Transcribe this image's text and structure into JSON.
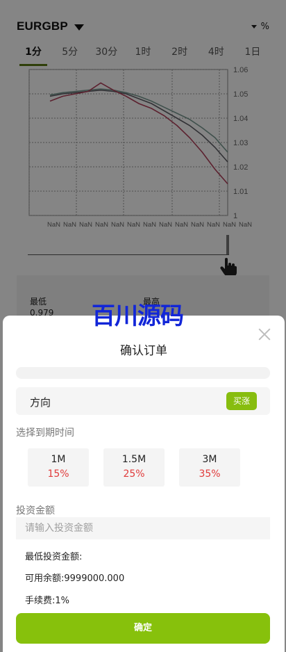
{
  "header": {
    "pair": "EURGBP",
    "percent_toggle": "%"
  },
  "timeframes": [
    {
      "label": "1分",
      "active": true
    },
    {
      "label": "5分",
      "active": false
    },
    {
      "label": "30分",
      "active": false
    },
    {
      "label": "1时",
      "active": false
    },
    {
      "label": "2时",
      "active": false
    },
    {
      "label": "4时",
      "active": false
    },
    {
      "label": "1日",
      "active": false
    }
  ],
  "chart_data": {
    "type": "line",
    "yticks": [
      "1.06",
      "1.05",
      "1.04",
      "1.03",
      "1.02",
      "1.01",
      "1"
    ],
    "ylim": [
      1.0,
      1.06
    ],
    "xtick_labels": [
      "NaN",
      "NaN",
      "NaN",
      "NaN",
      "NaN",
      "NaN",
      "NaN",
      "NaN",
      "NaN",
      "NaN",
      "NaN",
      "NaN",
      "NaN"
    ],
    "grid": true,
    "series": [
      {
        "color": "#7a9a92",
        "y": [
          1.0495,
          1.0505,
          1.051,
          1.0515,
          1.052,
          1.0515,
          1.0505,
          1.049,
          1.047,
          1.0445,
          1.042,
          1.0395,
          1.036,
          1.032,
          1.026
        ]
      },
      {
        "color": "#5e5e66",
        "y": [
          1.049,
          1.05,
          1.0505,
          1.051,
          1.0515,
          1.051,
          1.05,
          1.048,
          1.046,
          1.043,
          1.04,
          1.037,
          1.033,
          1.028,
          1.022
        ]
      },
      {
        "color": "#b0405a",
        "y": [
          1.047,
          1.049,
          1.05,
          1.051,
          1.0545,
          1.0515,
          1.049,
          1.046,
          1.044,
          1.041,
          1.037,
          1.032,
          1.026,
          1.019,
          1.013
        ]
      }
    ]
  },
  "stats": {
    "low_label": "最低",
    "low_value": "0.979",
    "high_label": "最高"
  },
  "watermark": "百川源码",
  "order": {
    "title": "确认订单",
    "direction_label": "方向",
    "direction_value": "买涨",
    "expiry_label": "选择到期时间",
    "expiry_options": [
      {
        "duration": "1M",
        "rate": "15%"
      },
      {
        "duration": "1.5M",
        "rate": "25%"
      },
      {
        "duration": "3M",
        "rate": "35%"
      }
    ],
    "amount_label": "投资金额",
    "amount_placeholder": "请输入投资金额",
    "min_amount": "最低投资金额:",
    "balance": "可用余额:9999000.000",
    "fee": "手续费:1%",
    "confirm_label": "确定"
  },
  "colors": {
    "accent": "#87c10c",
    "rise_badge": "#87bd0f",
    "rate_red": "#e03a3a",
    "watermark": "#1226d8"
  }
}
